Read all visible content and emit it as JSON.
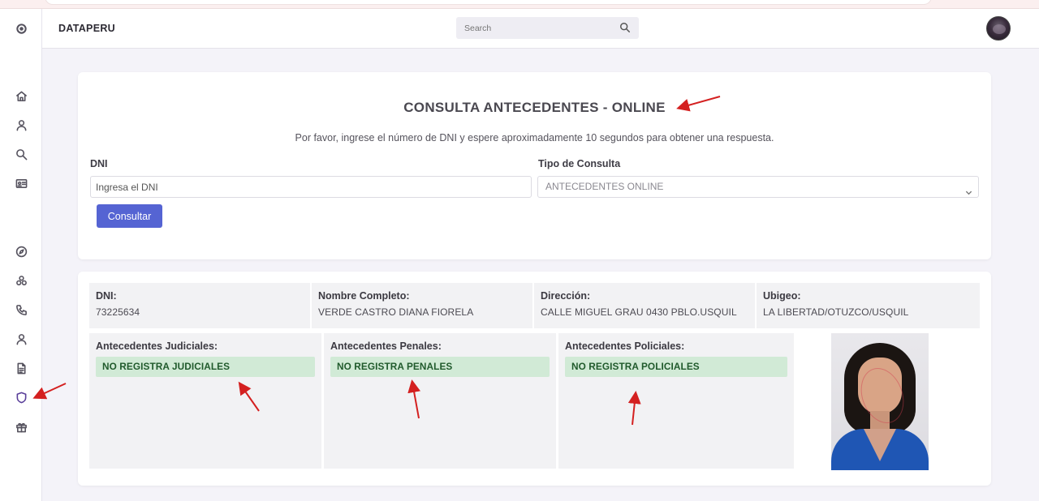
{
  "app": {
    "brand": "DATAPERU"
  },
  "search": {
    "placeholder": "Search"
  },
  "sidebar": {
    "icons": [
      "settings-icon",
      "home-icon",
      "user-icon",
      "search-icon",
      "id-card-icon",
      "compass-icon",
      "network-icon",
      "phone-icon",
      "user-icon",
      "document-icon",
      "shield-icon",
      "gift-icon"
    ],
    "active": "shield-icon"
  },
  "form": {
    "title": "CONSULTA ANTECEDENTES - ONLINE",
    "subtitle": "Por favor, ingrese el número de DNI y espere aproximadamente 10 segundos para obtener una respuesta.",
    "dni_label": "DNI",
    "dni_placeholder": "Ingresa el DNI",
    "tipo_label": "Tipo de Consulta",
    "tipo_selected": "ANTECEDENTES ONLINE",
    "submit_label": "Consultar"
  },
  "result": {
    "dni": {
      "label": "DNI:",
      "value": "73225634"
    },
    "nombre": {
      "label": "Nombre Completo:",
      "value": "VERDE CASTRO DIANA FIORELA"
    },
    "direccion": {
      "label": "Dirección:",
      "value": "CALLE MIGUEL GRAU 0430 PBLO.USQUIL"
    },
    "ubigeo": {
      "label": "Ubigeo:",
      "value": "LA LIBERTAD/OTUZCO/USQUIL"
    },
    "judiciales": {
      "label": "Antecedentes Judiciales:",
      "value": "NO REGISTRA JUDICIALES"
    },
    "penales": {
      "label": "Antecedentes Penales:",
      "value": "NO REGISTRA PENALES"
    },
    "policiales": {
      "label": "Antecedentes Policiales:",
      "value": "NO REGISTRA POLICIALES"
    }
  },
  "colors": {
    "accent_button": "#5564d3",
    "success_bg": "#d1ead6",
    "success_text": "#205a2c",
    "annotation_arrow": "#d42020"
  }
}
